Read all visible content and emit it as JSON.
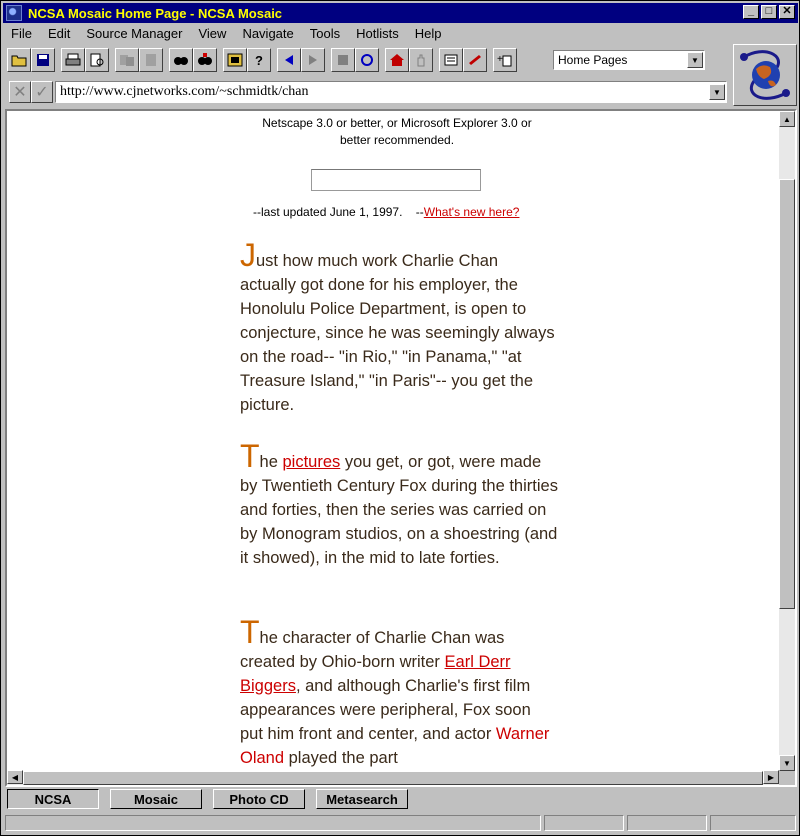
{
  "window": {
    "title": "NCSA Mosaic Home Page - NCSA Mosaic",
    "minimize": "_",
    "maximize": "□",
    "close": "✕"
  },
  "menu": [
    "File",
    "Edit",
    "Source Manager",
    "View",
    "Navigate",
    "Tools",
    "Hotlists",
    "Help"
  ],
  "toolbar": {
    "hotlist_value": "Home Pages"
  },
  "address": {
    "url": "http://www.cjnetworks.com/~schmidtk/chan"
  },
  "page": {
    "browser_note_1": "Netscape 3.0 or better, or Microsoft Explorer 3.0 or",
    "browser_note_2": "better recommended.",
    "updated_text": "--last updated June 1, 1997.",
    "whats_new_prefix": "--",
    "whats_new_link": "What's new here?",
    "p1": {
      "drop": "J",
      "text": "ust how much work Charlie Chan actually got done for his employer, the Honolulu Police Department, is open to conjecture, since he was seemingly always on the road-- \"in Rio,\" \"in Panama,\" \"at Treasure Island,\" \"in Paris\"-- you get the picture."
    },
    "p2": {
      "drop": "T",
      "pre": "he ",
      "link": "pictures",
      "post": " you get, or got, were made by Twentieth Century Fox during the thirties and forties, then the series was carried on by Monogram studios, on a shoestring (and it showed), in the mid to late forties."
    },
    "p3": {
      "drop": "T",
      "pre": "he character of Charlie Chan was created by Ohio-born writer ",
      "link": "Earl Derr Biggers",
      "mid": ", and although Charlie's first film appearances were peripheral, Fox soon put him front and center, and actor ",
      "red": "Warner Oland",
      "post": " played the part"
    }
  },
  "bottom_buttons": [
    "NCSA",
    "Mosaic",
    "Photo CD",
    "Metasearch"
  ]
}
